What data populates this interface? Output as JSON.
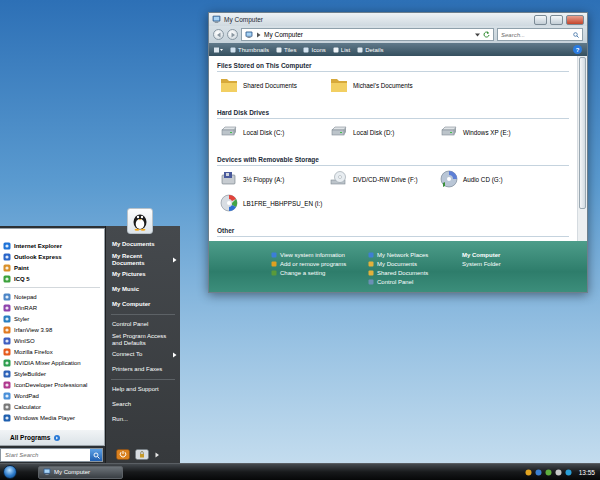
{
  "window": {
    "title": "My Computer",
    "address": "My Computer",
    "search_placeholder": "Search...",
    "help": "?",
    "views": [
      {
        "label": "Thumbnails"
      },
      {
        "label": "Tiles"
      },
      {
        "label": "Icons"
      },
      {
        "label": "List"
      },
      {
        "label": "Details"
      }
    ],
    "groups": [
      {
        "title": "Files Stored on This Computer",
        "items": [
          {
            "label": "Shared Documents",
            "kind": "folder"
          },
          {
            "label": "Michael's Documents",
            "kind": "folder"
          }
        ]
      },
      {
        "title": "Hard Disk Drives",
        "items": [
          {
            "label": "Local Disk (C:)",
            "kind": "disk"
          },
          {
            "label": "Local Disk (D:)",
            "kind": "disk"
          },
          {
            "label": "Windows XP (E:)",
            "kind": "disk"
          }
        ]
      },
      {
        "title": "Devices with Removable Storage",
        "items": [
          {
            "label": "3½ Floppy (A:)",
            "kind": "floppy"
          },
          {
            "label": "DVD/CD-RW Drive (F:)",
            "kind": "dvd"
          },
          {
            "label": "Audio CD (G:)",
            "kind": "cd"
          },
          {
            "label": "LB1FRE_HBHPPSU_EN (I:)",
            "kind": "install"
          }
        ]
      },
      {
        "title": "Other",
        "items": []
      }
    ],
    "details": {
      "tasks": [
        "View system information",
        "Add or remove programs",
        "Change a setting"
      ],
      "places": [
        "My Network Places",
        "My Documents",
        "Shared Documents",
        "Control Panel"
      ],
      "name": "My Computer",
      "type": "System Folder"
    }
  },
  "start_menu": {
    "pinned": [
      "Internet Explorer",
      "Outlook Express",
      "Paint",
      "ICQ 5"
    ],
    "recent": [
      "Notepad",
      "WinRAR",
      "Styler",
      "IrfanView 3.98",
      "WinISO",
      "Mozilla Firefox",
      "NVIDIA Mixer Application",
      "StyleBuilder",
      "IconDeveloper Professional",
      "WordPad",
      "Calculator",
      "Windows Media Player"
    ],
    "all_programs": "All Programs",
    "search_placeholder": "Start Search",
    "sections": [
      {
        "items": [
          {
            "label": "My Documents",
            "bold": true,
            "submenu": false
          },
          {
            "label": "My Recent Documents",
            "bold": true,
            "submenu": true
          },
          {
            "label": "My Pictures",
            "bold": true,
            "submenu": false
          },
          {
            "label": "My Music",
            "bold": true,
            "submenu": false
          },
          {
            "label": "My Computer",
            "bold": true,
            "submenu": false
          }
        ]
      },
      {
        "items": [
          {
            "label": "Control Panel",
            "bold": false,
            "submenu": false
          },
          {
            "label": "Set Program Access and Defaults",
            "bold": false,
            "submenu": false
          },
          {
            "label": "Connect To",
            "bold": false,
            "submenu": true
          },
          {
            "label": "Printers and Faxes",
            "bold": false,
            "submenu": false
          }
        ]
      },
      {
        "items": [
          {
            "label": "Help and Support",
            "bold": false,
            "submenu": false
          },
          {
            "label": "Search",
            "bold": false,
            "submenu": false
          },
          {
            "label": "Run...",
            "bold": false,
            "submenu": false
          }
        ]
      }
    ]
  },
  "taskbar": {
    "buttons": [
      {
        "label": "My Computer",
        "selected": true
      }
    ],
    "clock": "13:55"
  }
}
